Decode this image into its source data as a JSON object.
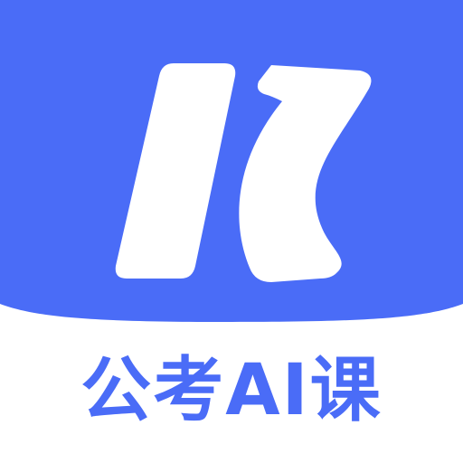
{
  "app_icon": {
    "name": "公考AI课",
    "logo_icon": "k-mark-icon"
  },
  "colors": {
    "brand_blue": "#4A6CF7",
    "white": "#FFFFFF"
  }
}
